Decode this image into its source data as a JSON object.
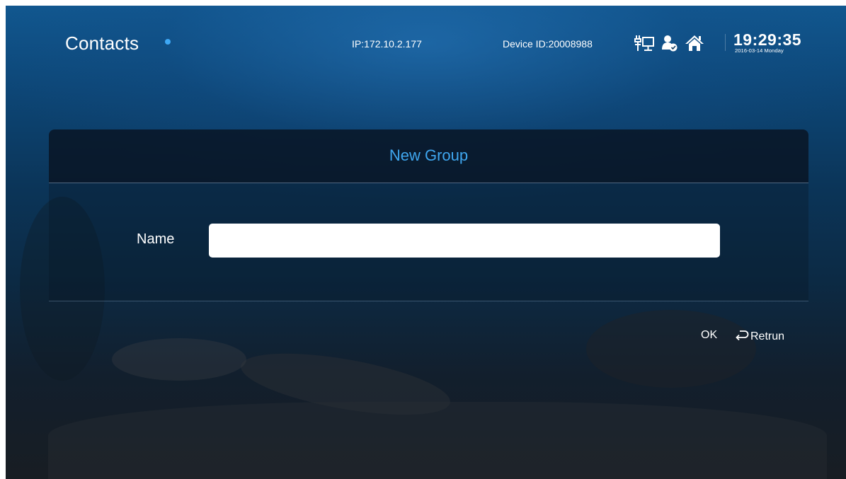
{
  "header": {
    "app_title": "Contacts",
    "ip": "IP:172.10.2.177",
    "device_id": "Device ID:20008988",
    "status_icons": [
      "network-icon",
      "user-status-icon",
      "home-icon"
    ],
    "time": "19:29:35",
    "date": "2016-03-14 Monday"
  },
  "dialog": {
    "title": "New Group",
    "name_label": "Name",
    "name_value": "",
    "ok_label": "OK",
    "return_label": "Retrun",
    "return_icon": "return-arrow-icon"
  },
  "colors": {
    "accent": "#3fa6ee",
    "title_dot": "#3ea8f5"
  }
}
